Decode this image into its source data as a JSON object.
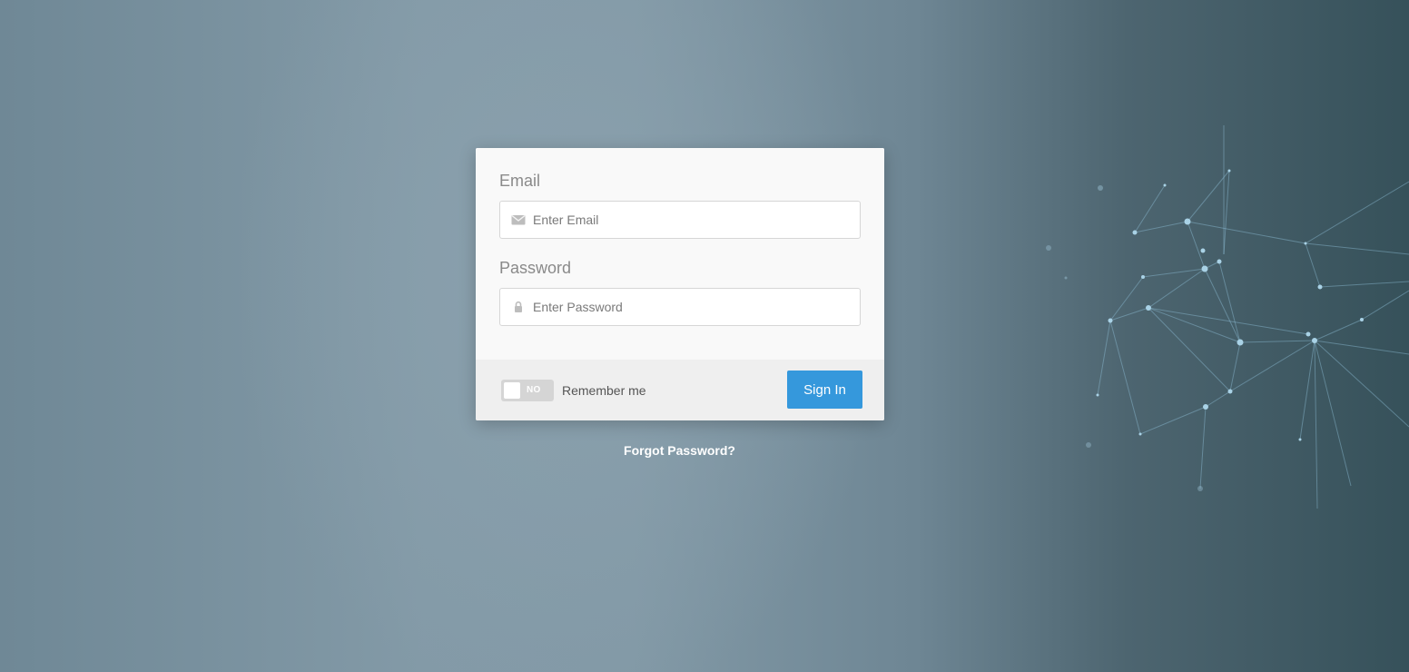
{
  "login": {
    "email_label": "Email",
    "email_placeholder": "Enter Email",
    "email_icon": "envelope-icon",
    "password_label": "Password",
    "password_placeholder": "Enter Password",
    "password_icon": "lock-icon",
    "remember_toggle_state": "NO",
    "remember_label": "Remember me",
    "signin_label": "Sign In",
    "forgot_label": "Forgot Password?"
  },
  "colors": {
    "accent": "#3598dc",
    "card_bg": "#f9f9f9",
    "footer_bg": "#efefef"
  }
}
